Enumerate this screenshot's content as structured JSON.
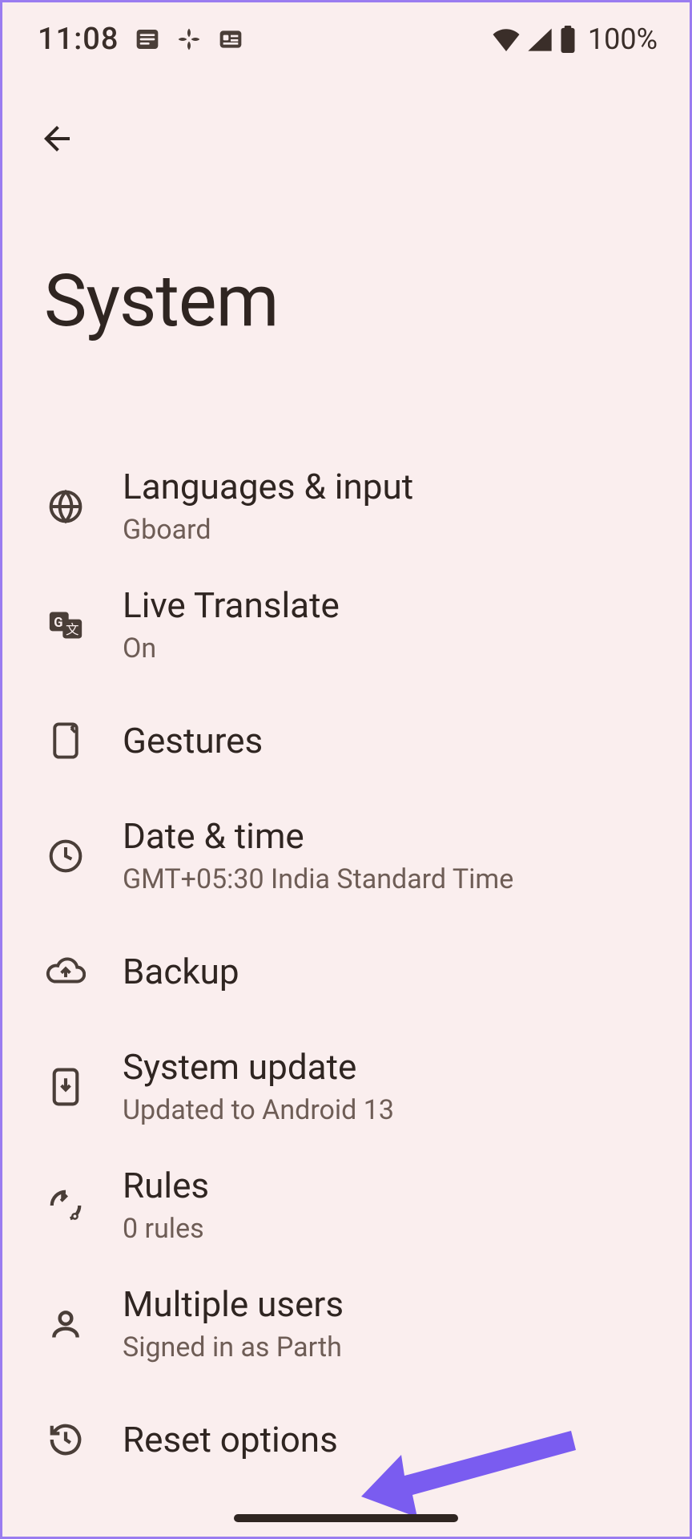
{
  "statusBar": {
    "time": "11:08",
    "batteryPct": "100%"
  },
  "page": {
    "title": "System"
  },
  "items": [
    {
      "icon": "globe-icon",
      "title": "Languages & input",
      "subtitle": "Gboard"
    },
    {
      "icon": "translate-icon",
      "title": "Live Translate",
      "subtitle": "On"
    },
    {
      "icon": "gestures-icon",
      "title": "Gestures",
      "subtitle": ""
    },
    {
      "icon": "clock-icon",
      "title": "Date & time",
      "subtitle": "GMT+05:30 India Standard Time"
    },
    {
      "icon": "cloud-upload-icon",
      "title": "Backup",
      "subtitle": ""
    },
    {
      "icon": "system-update-icon",
      "title": "System update",
      "subtitle": "Updated to Android 13"
    },
    {
      "icon": "rules-icon",
      "title": "Rules",
      "subtitle": "0 rules"
    },
    {
      "icon": "person-icon",
      "title": "Multiple users",
      "subtitle": "Signed in as Parth"
    },
    {
      "icon": "history-icon",
      "title": "Reset options",
      "subtitle": ""
    }
  ]
}
